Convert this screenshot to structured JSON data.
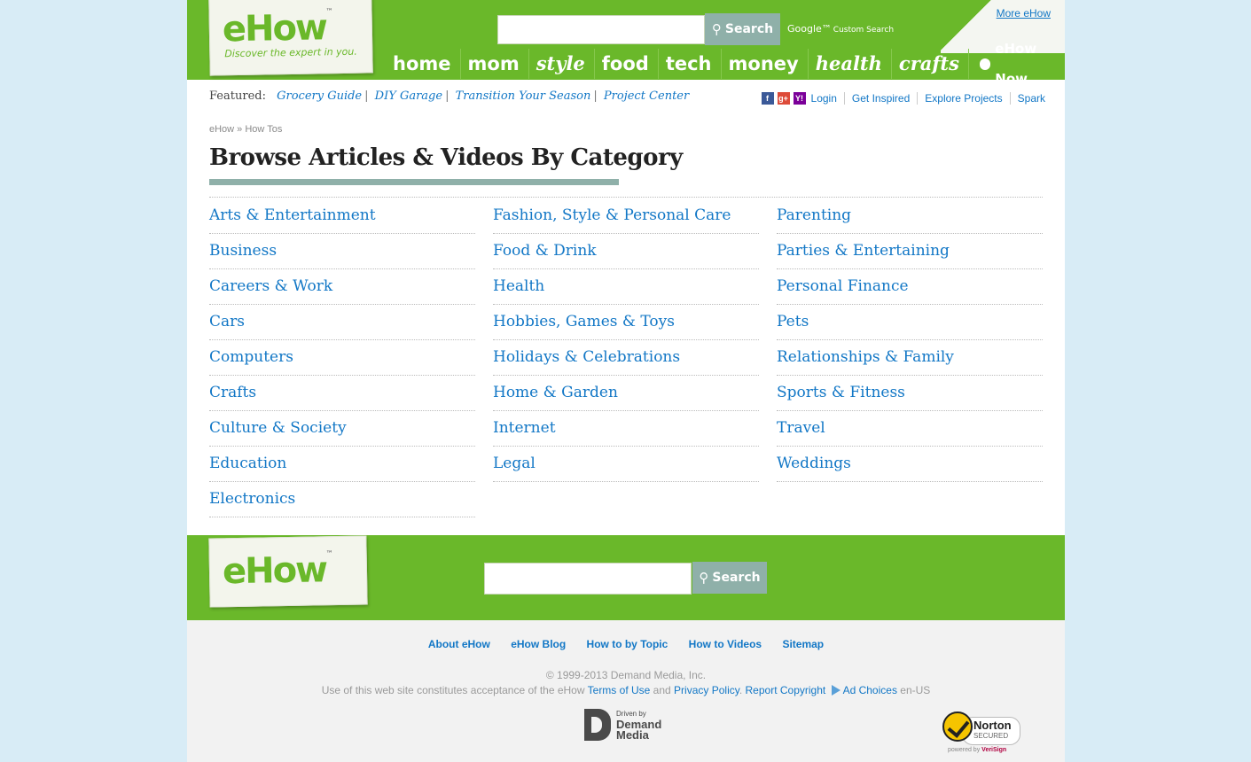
{
  "header": {
    "logo": "eHow",
    "tagline": "Discover the expert in you.",
    "search_button": "Search",
    "google_label": "Google™",
    "custom_search": "Custom Search",
    "more_ehow": "More eHow",
    "nav": [
      {
        "label": "home"
      },
      {
        "label": "mom"
      },
      {
        "label": "style"
      },
      {
        "label": "food"
      },
      {
        "label": "tech"
      },
      {
        "label": "money"
      },
      {
        "label": "health"
      },
      {
        "label": "crafts"
      },
      {
        "label": "eHow Now"
      }
    ]
  },
  "featured": {
    "label": "Featured:",
    "links": [
      "Grocery Guide",
      "DIY Garage",
      "Transition Your Season",
      "Project Center"
    ]
  },
  "utility": {
    "social_icons": [
      "facebook-icon",
      "google-plus-icon",
      "yahoo-icon"
    ],
    "links": [
      "Login",
      "Get Inspired",
      "Explore Projects",
      "Spark"
    ]
  },
  "breadcrumb": "eHow » How Tos",
  "page_title": "Browse Articles & Videos By Category",
  "categories": {
    "col1": [
      "Arts & Entertainment",
      "Business",
      "Careers & Work",
      "Cars",
      "Computers",
      "Crafts",
      "Culture & Society",
      "Education",
      "Electronics"
    ],
    "col2": [
      "Fashion, Style & Personal Care",
      "Food & Drink",
      "Health",
      "Hobbies, Games & Toys",
      "Holidays & Celebrations",
      "Home & Garden",
      "Internet",
      "Legal"
    ],
    "col3": [
      "Parenting",
      "Parties & Entertaining",
      "Personal Finance",
      "Pets",
      "Relationships & Family",
      "Sports & Fitness",
      "Travel",
      "Weddings"
    ]
  },
  "footer": {
    "logo": "eHow",
    "search_button": "Search",
    "links": [
      "About eHow",
      "eHow Blog",
      "How to by Topic",
      "How to Videos",
      "Sitemap"
    ],
    "copyright": "© 1999-2013 Demand Media, Inc.",
    "legal_prefix": "Use of this web site constitutes acceptance of the eHow",
    "terms": "Terms of Use",
    "and": "and",
    "privacy": "Privacy Policy",
    "report": "Report Copyright",
    "ad_choices": "Ad Choices",
    "locale": "en-US",
    "dm_small": "Driven by",
    "dm_line1": "Demand",
    "dm_line2": "Media",
    "norton_name": "Norton",
    "norton_secured": "SECURED",
    "norton_powered": "powered by",
    "norton_verisign": "VeriSign"
  },
  "colors": {
    "brand_green": "#6ab82a",
    "link_blue": "#1277c6",
    "accent_teal": "#8fb0a9"
  }
}
